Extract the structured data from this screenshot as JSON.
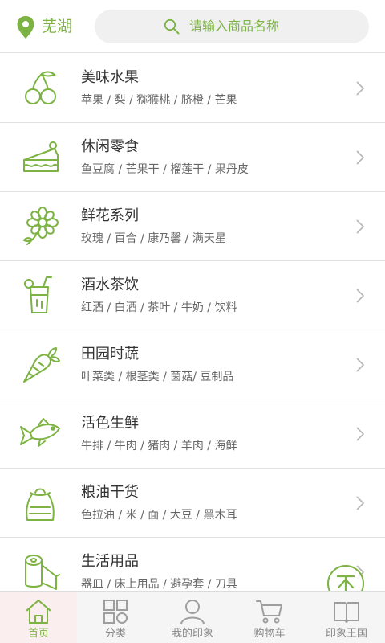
{
  "header": {
    "location": "芜湖",
    "search_placeholder": "请输入商品名称"
  },
  "categories": [
    {
      "title": "美味水果",
      "items": "苹果 / 梨 / 猕猴桃 / 脐橙 / 芒果",
      "icon": "cherry-icon"
    },
    {
      "title": "休闲零食",
      "items": "鱼豆腐 / 芒果干 / 榴莲干 / 果丹皮",
      "icon": "cake-icon"
    },
    {
      "title": "鲜花系列",
      "items": "玫瑰 / 百合 / 康乃馨 / 满天星",
      "icon": "flower-icon"
    },
    {
      "title": "酒水茶饮",
      "items": "红酒 / 白酒 / 茶叶 / 牛奶 / 饮料",
      "icon": "drink-icon"
    },
    {
      "title": "田园时蔬",
      "items": "叶菜类 / 根茎类 / 菌菇/ 豆制品",
      "icon": "carrot-icon"
    },
    {
      "title": "活色生鲜",
      "items": "牛排 / 牛肉 / 猪肉 / 羊肉 / 海鲜",
      "icon": "fish-icon"
    },
    {
      "title": "粮油干货",
      "items": "色拉油 / 米 / 面 / 大豆 / 黑木耳",
      "icon": "grain-sack-icon"
    },
    {
      "title": "生活用品",
      "items": "器皿 / 床上用品 / 避孕套 / 刀具",
      "icon": "tissue-roll-icon"
    }
  ],
  "tabs": [
    {
      "label": "首页",
      "icon": "home-icon",
      "active": true
    },
    {
      "label": "分类",
      "icon": "category-grid-icon",
      "active": false
    },
    {
      "label": "我的印象",
      "icon": "user-icon",
      "active": false
    },
    {
      "label": "购物车",
      "icon": "cart-icon",
      "active": false
    },
    {
      "label": "印象王国",
      "icon": "book-icon",
      "active": false
    }
  ],
  "colors": {
    "accent": "#7cb342",
    "divider": "#e2e2e2",
    "tab_inactive": "#888888"
  }
}
